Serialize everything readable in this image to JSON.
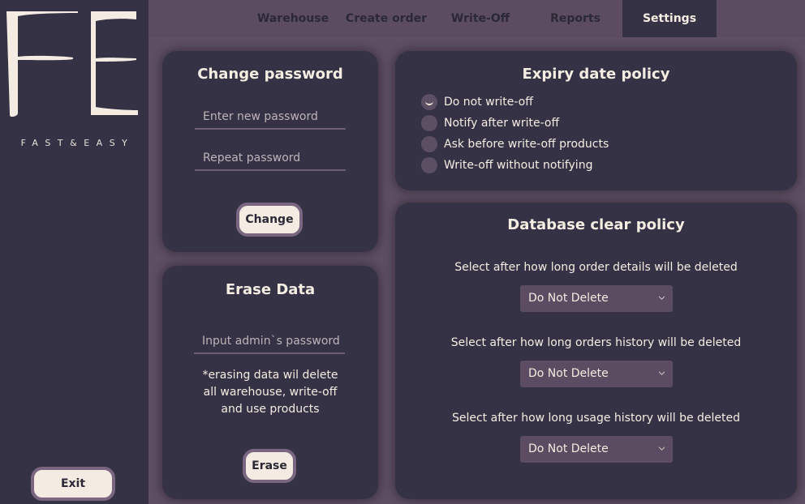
{
  "sidebar": {
    "brand": "FAST&EASY",
    "exit_label": "Exit"
  },
  "tabs": [
    {
      "label": "Warehouse",
      "active": false
    },
    {
      "label": "Create order",
      "active": false
    },
    {
      "label": "Write-Off",
      "active": false
    },
    {
      "label": "Reports",
      "active": false
    },
    {
      "label": "Settings",
      "active": true
    }
  ],
  "change_password": {
    "title": "Change password",
    "new_placeholder": "Enter new password",
    "repeat_placeholder": "Repeat password",
    "button": "Change"
  },
  "erase_data": {
    "title": "Erase Data",
    "placeholder": "Input admin`s password",
    "note_lines": [
      "*erasing data wil delete",
      "all warehouse, write-off",
      "and use products"
    ],
    "button": "Erase"
  },
  "expiry": {
    "title": "Expiry date policy",
    "options": [
      {
        "label": "Do not write-off",
        "checked": true
      },
      {
        "label": "Notify after write-off",
        "checked": false
      },
      {
        "label": "Ask before write-off products",
        "checked": false
      },
      {
        "label": "Write-off without notifying",
        "checked": false
      }
    ]
  },
  "db_clear": {
    "title": "Database clear policy",
    "items": [
      {
        "label": "Select after how long order details will be deleted",
        "value": "Do Not Delete"
      },
      {
        "label": "Select after how long orders history will be deleted",
        "value": "Do Not Delete"
      },
      {
        "label": "Select after how long usage history will be deleted",
        "value": "Do Not Delete"
      }
    ]
  },
  "colors": {
    "background": "#5e4f63",
    "panel": "#363246",
    "accent": "#f4ece2",
    "border": "#7a6680"
  }
}
